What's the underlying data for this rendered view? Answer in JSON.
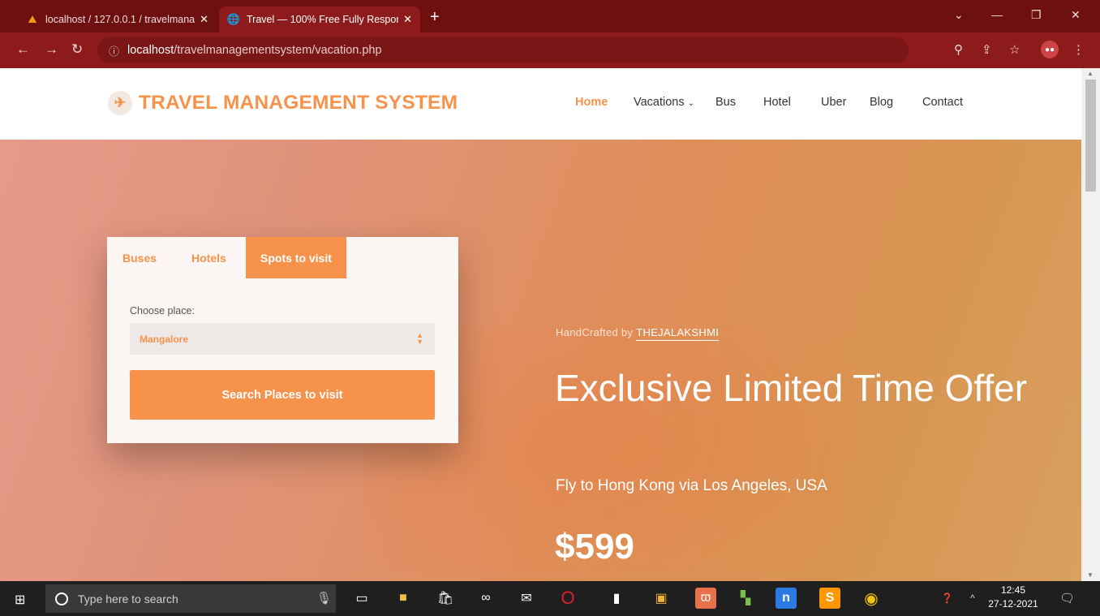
{
  "browser": {
    "tabs": [
      {
        "title": "localhost / 127.0.0.1 / travelmana",
        "favicon": "phpmyadmin-icon",
        "active": false
      },
      {
        "title": "Travel — 100% Free Fully Respon",
        "favicon": "globe-icon",
        "active": true
      }
    ],
    "url_host": "localhost",
    "url_path": "/travelmanagementsystem/vacation.php",
    "accent": "#8e1b1b"
  },
  "site": {
    "logo": "TRAVEL MANAGEMENT SYSTEM",
    "nav": [
      "Home",
      "Vacations",
      "Bus",
      "Hotel",
      "Uber",
      "Blog",
      "Contact"
    ],
    "accent": "#f7924a"
  },
  "search_card": {
    "tabs": [
      "Buses",
      "Hotels",
      "Spots to visit"
    ],
    "place_label": "Choose place:",
    "place_value": "Mangalore",
    "button": "Search Places to visit"
  },
  "hero": {
    "handcrafted_prefix": "HandCrafted by",
    "handcrafted_author": "THEJALAKSHMI",
    "headline": "Exclusive Limited Time Offer",
    "subline": "Fly to Hong Kong via Los Angeles, USA",
    "price": "$599"
  },
  "taskbar": {
    "search_placeholder": "Type here to search",
    "time": "12:45",
    "date": "27-12-2021"
  }
}
